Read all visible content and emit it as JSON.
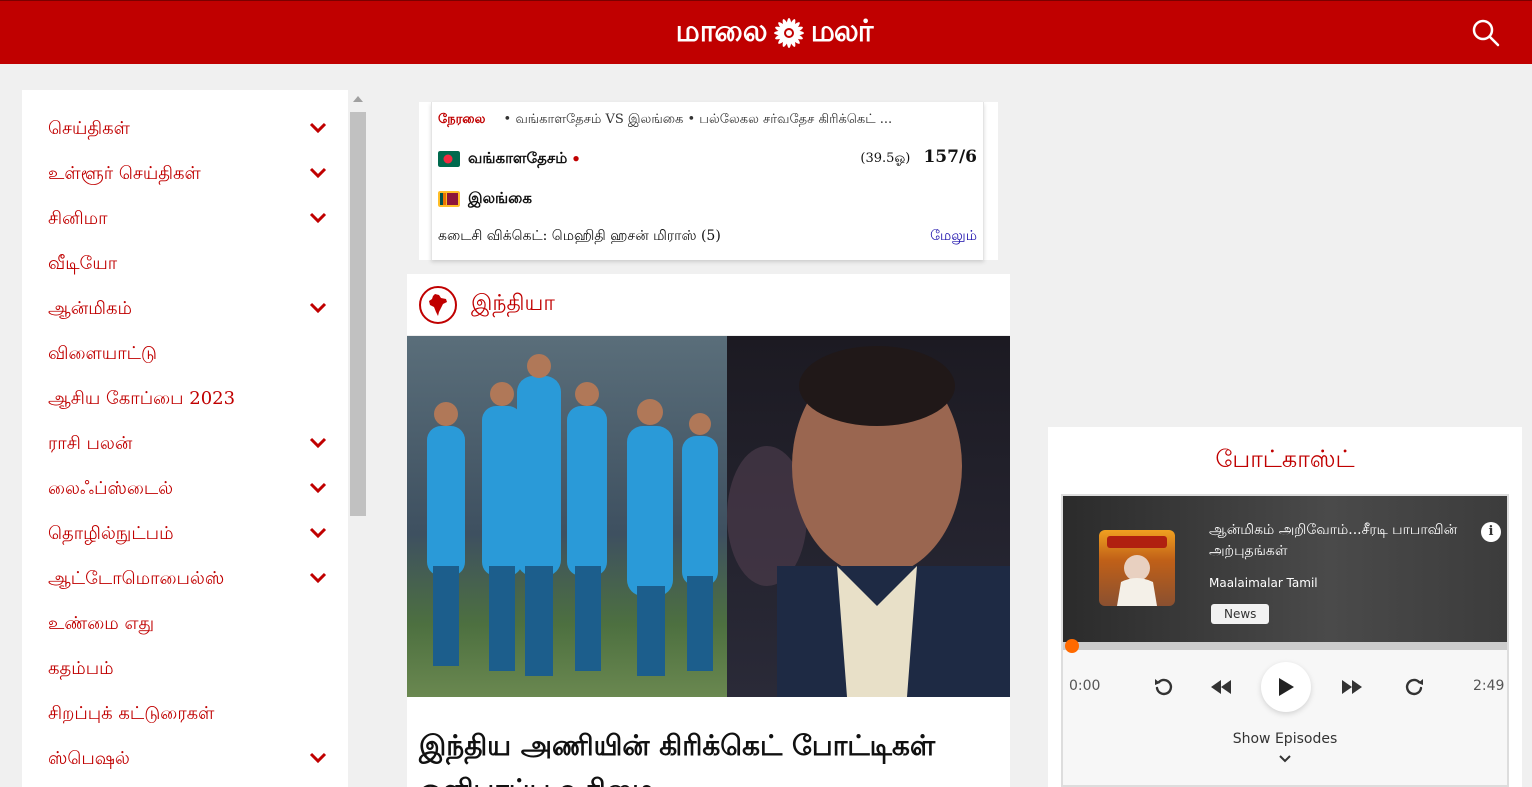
{
  "header": {
    "logo_left": "மாலை",
    "logo_right": "மலர்",
    "search_icon": "search-icon"
  },
  "sidebar": {
    "items": [
      {
        "label": "செய்திகள்",
        "expandable": true
      },
      {
        "label": "உள்ளூர் செய்திகள்",
        "expandable": true
      },
      {
        "label": "சினிமா",
        "expandable": true
      },
      {
        "label": "வீடியோ",
        "expandable": false
      },
      {
        "label": "ஆன்மிகம்",
        "expandable": true
      },
      {
        "label": "விளையாட்டு",
        "expandable": false
      },
      {
        "label": "ஆசிய கோப்பை 2023",
        "expandable": false
      },
      {
        "label": "ராசி பலன்",
        "expandable": true
      },
      {
        "label": "லைஃப்ஸ்டைல்",
        "expandable": true
      },
      {
        "label": "தொழில்நுட்பம்",
        "expandable": true
      },
      {
        "label": "ஆட்டோமொபைல்ஸ்",
        "expandable": true
      },
      {
        "label": "உண்மை எது",
        "expandable": false
      },
      {
        "label": "கதம்பம்",
        "expandable": false
      },
      {
        "label": "சிறப்புக் கட்டுரைகள்",
        "expandable": false
      },
      {
        "label": "ஸ்பெஷல்",
        "expandable": true
      }
    ]
  },
  "score": {
    "live_label": "நேரலை",
    "match_info": "• வங்காளதேசம் VS இலங்கை • பல்லேகல சர்வதேச கிரிக்கெட் ...",
    "team1": "வங்காளதேசம்",
    "team1_live_dot": "•",
    "team1_overs": "(39.5ஓ)",
    "team1_score": "157/6",
    "team2": "இலங்கை",
    "last_wicket": "கடைசி விக்கெட்: மெஹிதி ஹசன் மிராஸ் (5)",
    "more_label": "மேலும்"
  },
  "news_card": {
    "section_title": "இந்தியா",
    "section_icon": "india-map-icon",
    "headline": "இந்திய அணியின் கிரிக்கெட் போட்டிகள் ஒளிபரப்பு உரிமை"
  },
  "podcast": {
    "title": "போட்காஸ்ட்",
    "episode_title": "ஆன்மிகம் அறிவோம்...சீரடி பாபாவின் அற்புதங்கள்",
    "author": "Maalaimalar Tamil",
    "tag": "News",
    "current_time": "0:00",
    "duration": "2:49",
    "progress": 0.0,
    "show_episodes": "Show Episodes"
  },
  "colors": {
    "brand_red": "#c00000",
    "progress_orange": "#ff6a00"
  }
}
